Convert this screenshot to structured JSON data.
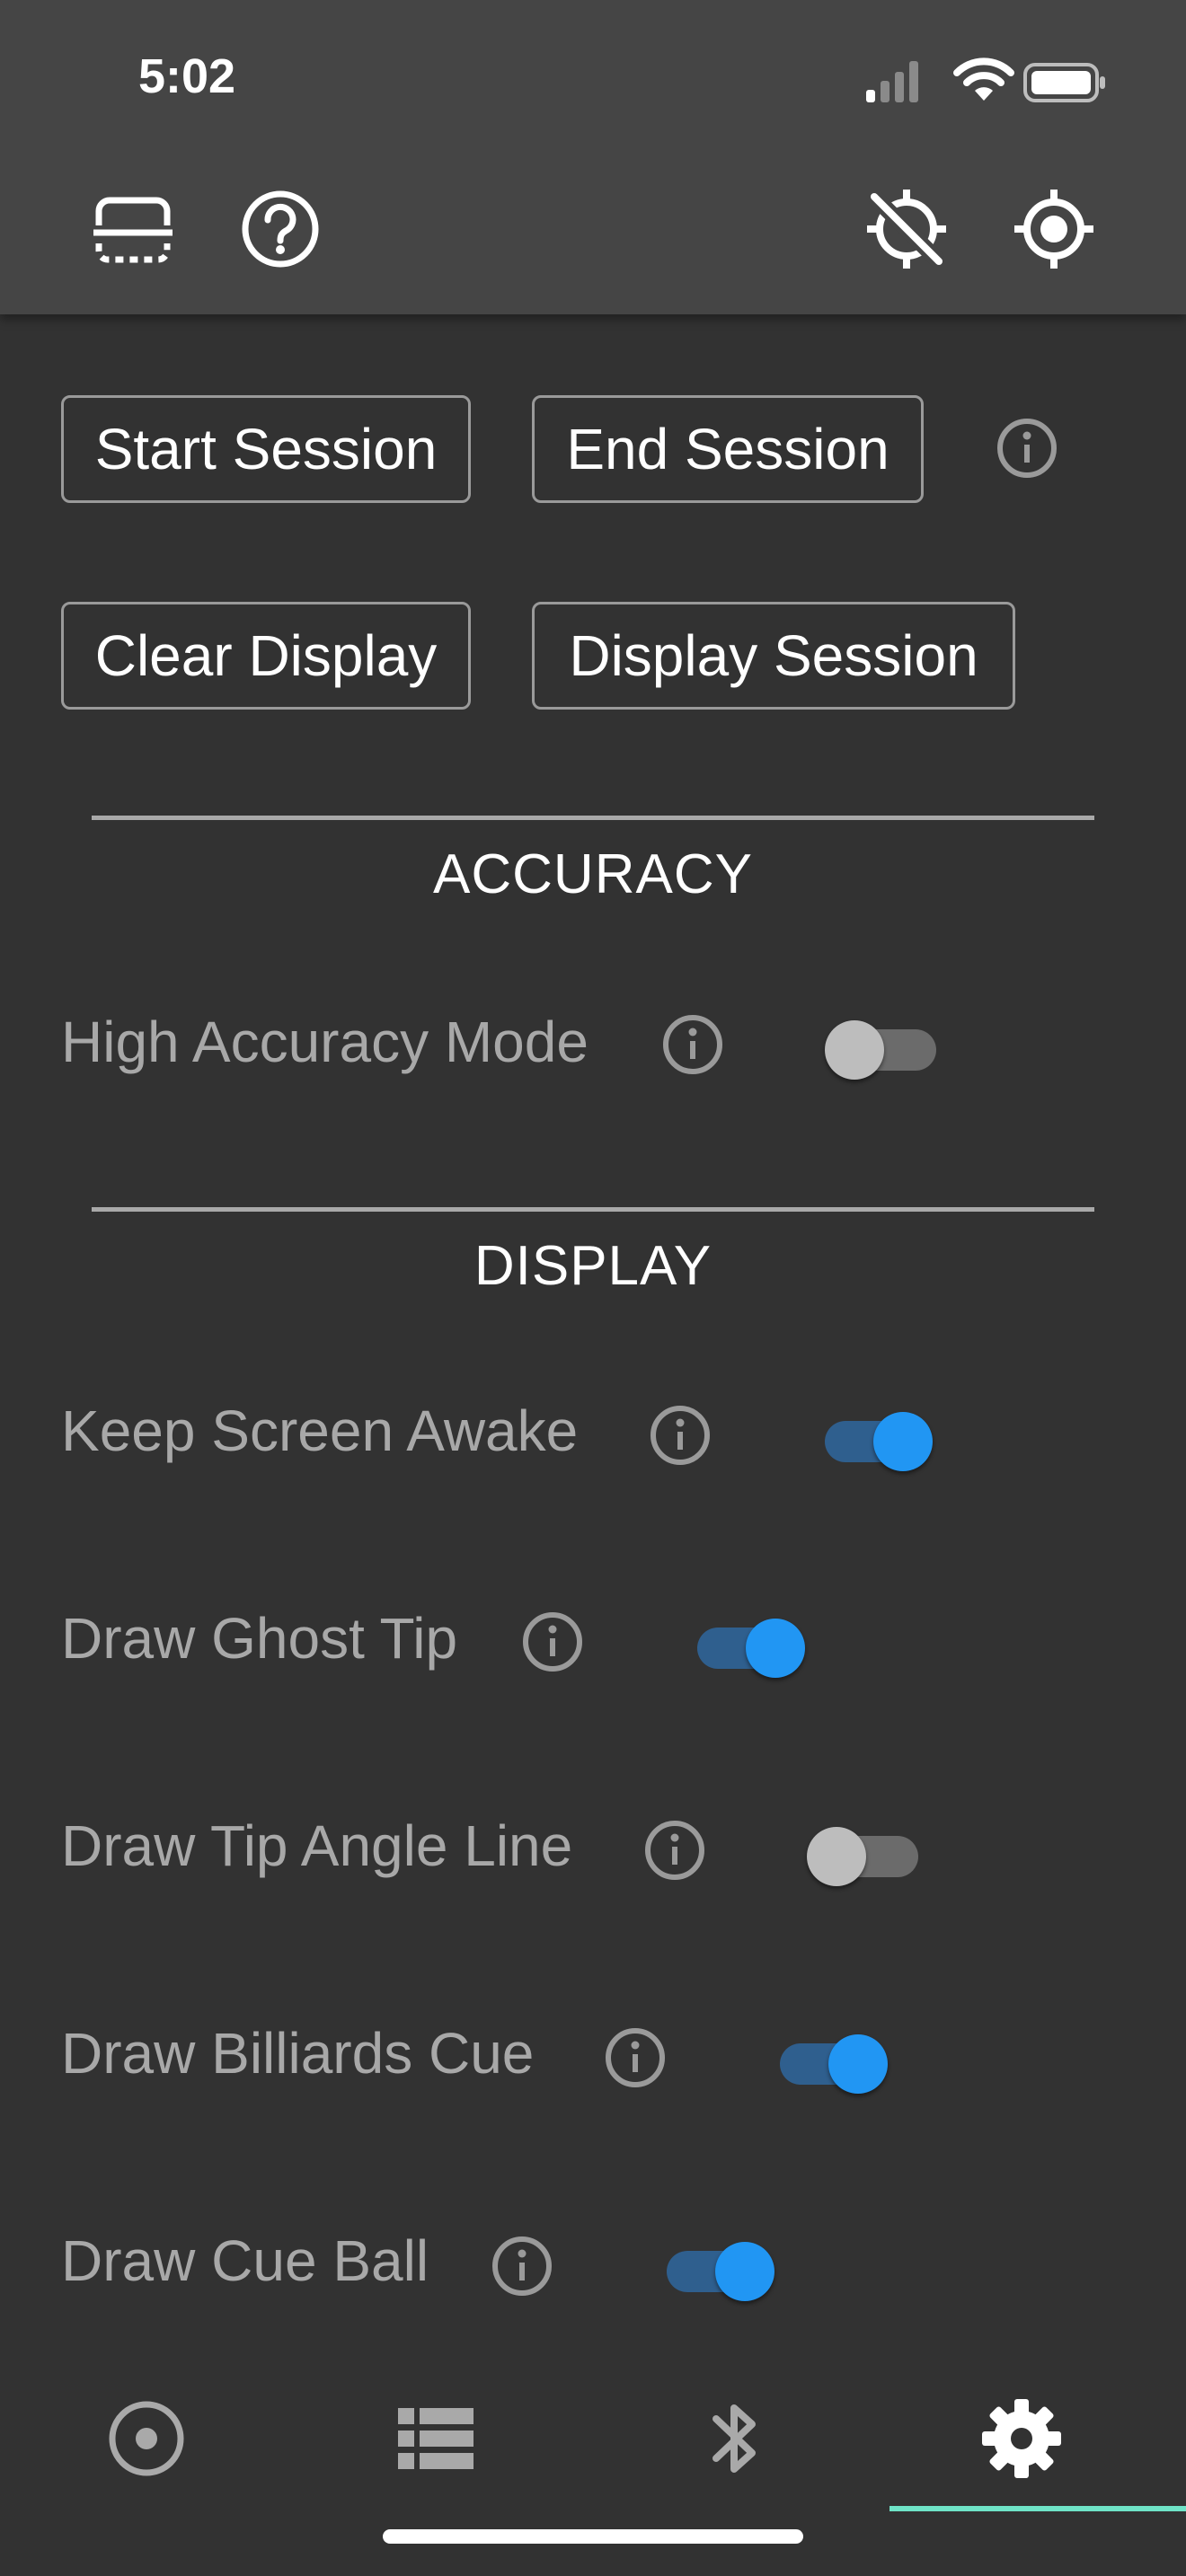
{
  "status_bar": {
    "time": "5:02",
    "icons": [
      "cellular-signal-icon",
      "wifi-icon",
      "battery-icon"
    ]
  },
  "app_bar": {
    "left_icons": [
      "scan-frame-icon",
      "help-circle-icon"
    ],
    "right_icons": [
      "location-off-icon",
      "location-target-icon"
    ]
  },
  "session": {
    "start_label": "Start Session",
    "end_label": "End Session",
    "clear_label": "Clear Display",
    "display_label": "Display Session"
  },
  "accuracy": {
    "title": "ACCURACY",
    "settings": [
      {
        "label": "High Accuracy Mode",
        "enabled": false
      }
    ]
  },
  "display": {
    "title": "DISPLAY",
    "settings": [
      {
        "label": "Keep Screen Awake",
        "enabled": true
      },
      {
        "label": "Draw Ghost Tip",
        "enabled": true
      },
      {
        "label": "Draw Tip Angle Line",
        "enabled": false
      },
      {
        "label": "Draw Billiards Cue",
        "enabled": true
      },
      {
        "label": "Draw Cue Ball",
        "enabled": true
      }
    ]
  },
  "bottom_nav": {
    "items": [
      "target-icon",
      "list-icon",
      "bluetooth-icon",
      "settings-gear-icon"
    ],
    "active": "settings-gear-icon"
  },
  "colors": {
    "background": "#323232",
    "app_bar": "#454545",
    "toggle_on": "#2196f3",
    "toggle_off": "#bdbdbd",
    "nav_indicator": "#6fe3c7"
  }
}
